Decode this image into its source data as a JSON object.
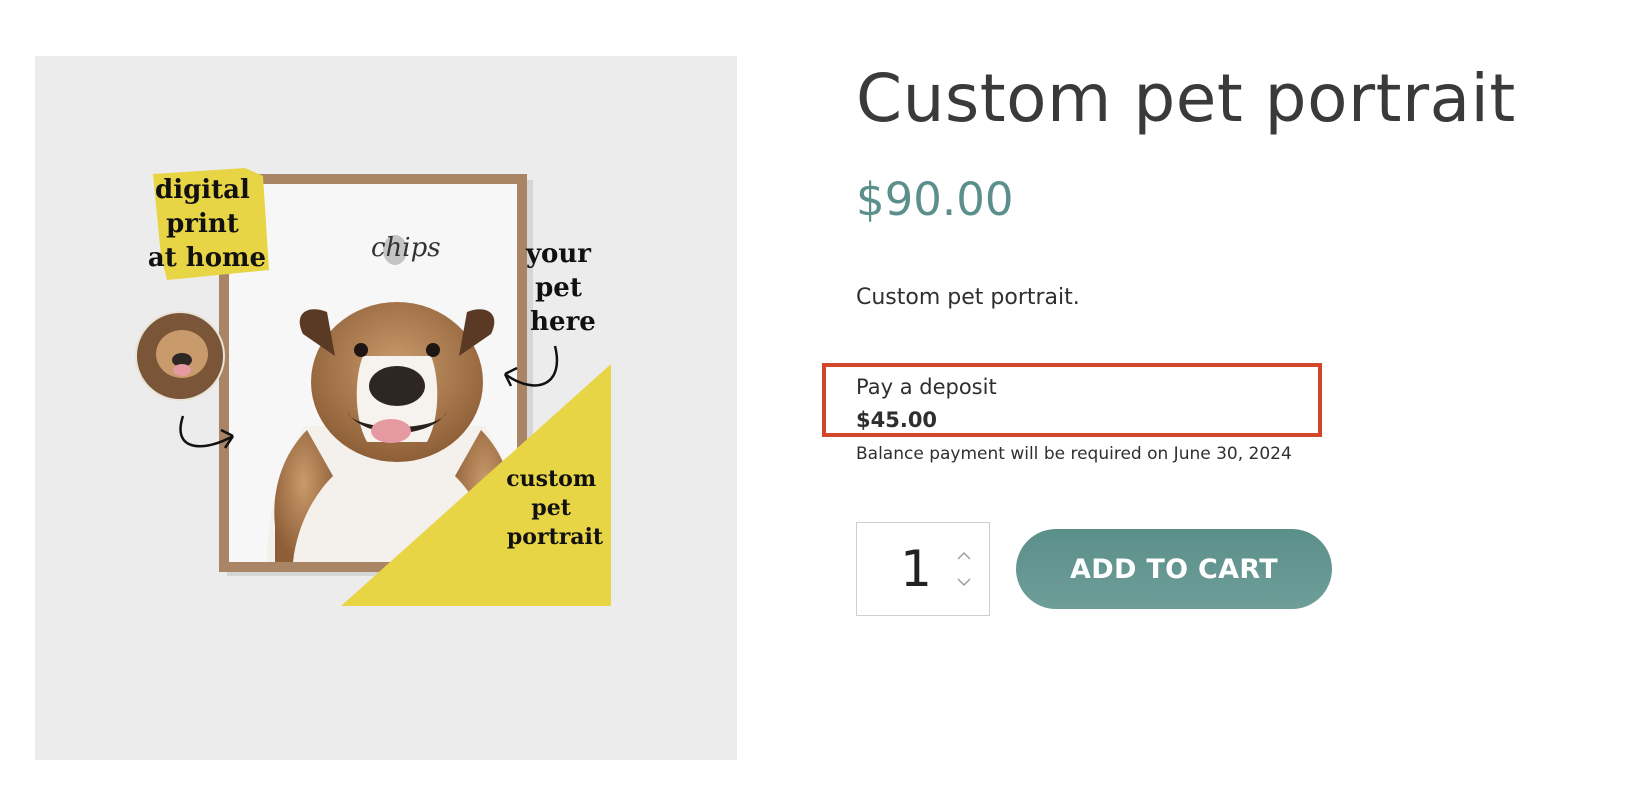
{
  "product": {
    "title": "Custom pet portrait",
    "price": "$90.00",
    "description": "Custom pet portrait."
  },
  "deposit": {
    "label": "Pay a deposit",
    "amount": "$45.00",
    "balance_note": "Balance payment will be required on June 30, 2024"
  },
  "quantity": {
    "value": "1"
  },
  "actions": {
    "add_to_cart": "ADD TO CART"
  },
  "image_overlay": {
    "badge_text": [
      "digital",
      "print",
      "at home"
    ],
    "pet_name": "chips",
    "callout_text": [
      "your",
      "pet",
      "here"
    ],
    "corner_text": [
      "custom",
      "pet",
      "portrait"
    ]
  },
  "colors": {
    "accent": "#5b8f8b",
    "highlight_border": "#d2462c",
    "yellow": "#e8d545",
    "image_bg": "#ececec"
  },
  "icons": {
    "quantity_up": "chevron-up-icon",
    "quantity_down": "chevron-down-icon"
  }
}
